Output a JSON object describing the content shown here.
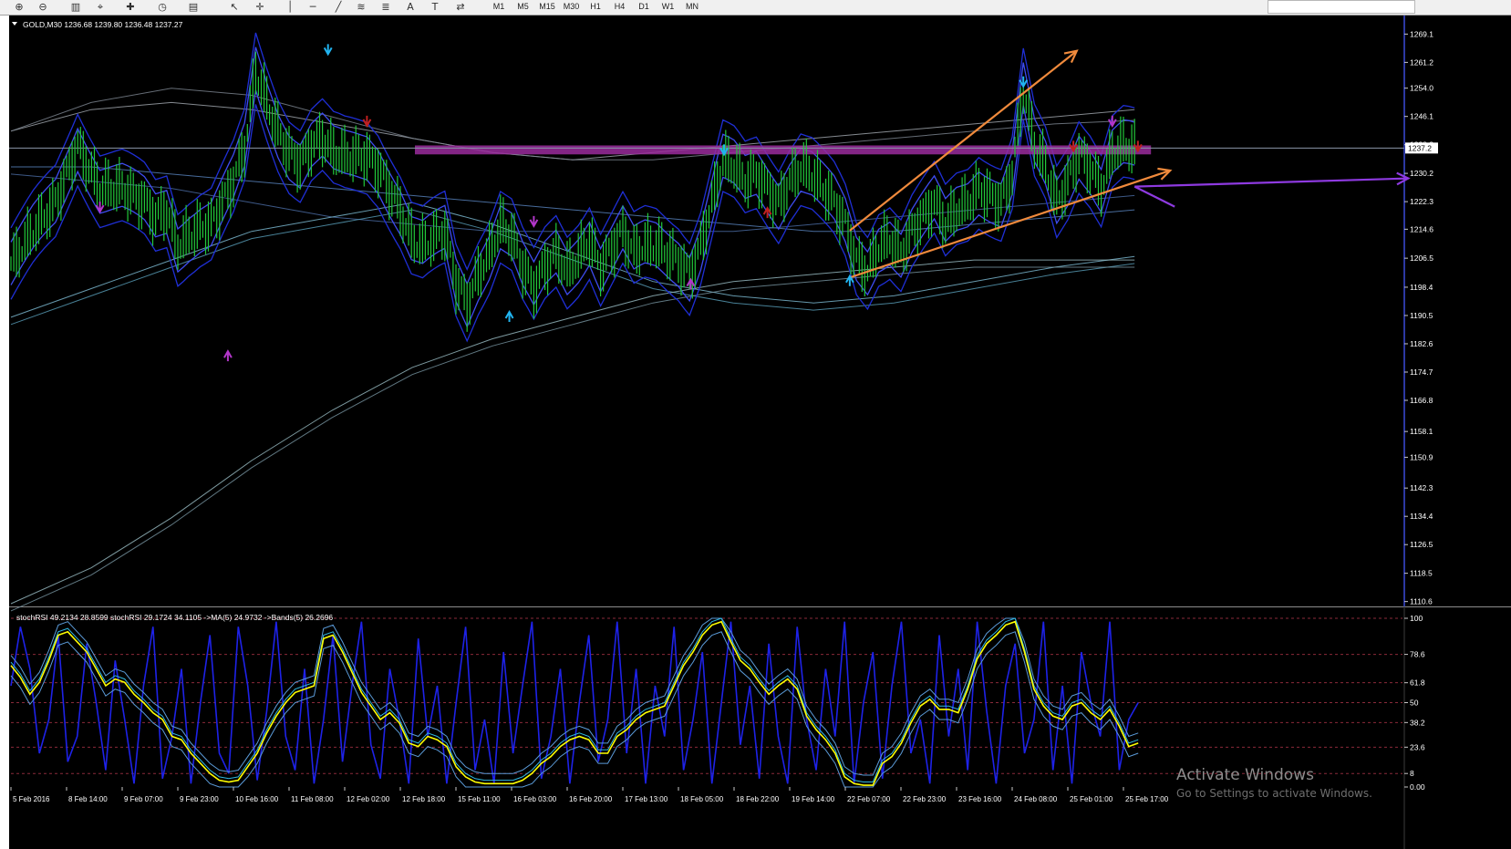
{
  "toolbar": {
    "icons": [
      "zoom-in-icon",
      "zoom-out-icon",
      "chart-bars-icon",
      "crosshair-cursor-icon",
      "new-order-icon",
      "history-clock-icon",
      "template-icon",
      "arrow-cursor-icon",
      "crosshair-icon",
      "vertical-line-icon",
      "horizontal-line-icon",
      "trendline-icon",
      "fibonacci-icon",
      "channel-icon",
      "text-icon",
      "text-label-icon",
      "arrows-icon"
    ],
    "timeframes": [
      "M1",
      "M5",
      "M15",
      "M30",
      "H1",
      "H4",
      "D1",
      "W1",
      "MN"
    ]
  },
  "chart_data": [
    {
      "type": "line",
      "header": "GOLD,M30  1236.68 1239.80 1236.48 1237.27",
      "symbol": "GOLD",
      "timeframe": "M30",
      "ohlc": {
        "open": 1236.68,
        "high": 1239.8,
        "low": 1236.48,
        "close": 1237.27
      },
      "current_price": 1237.27,
      "current_price_label": "1237.2",
      "ylim": [
        1110,
        1272
      ],
      "y_ticks": [
        "1269.1",
        "1261.2",
        "1254.0",
        "1246.1",
        "1238.2",
        "1230.2",
        "1222.3",
        "1214.6",
        "1206.5",
        "1198.4",
        "1190.5",
        "1182.6",
        "1174.7",
        "1166.8",
        "1158.1",
        "1150.9",
        "1142.3",
        "1134.4",
        "1126.5",
        "1118.5",
        "1110.6"
      ],
      "x_ticks": [
        "5 Feb 2016",
        "8 Feb 14:00",
        "9 Feb 07:00",
        "9 Feb 23:00",
        "10 Feb 16:00",
        "11 Feb 08:00",
        "12 Feb 02:00",
        "12 Feb 18:00",
        "15 Feb 11:00",
        "16 Feb 03:00",
        "16 Feb 20:00",
        "17 Feb 13:00",
        "18 Feb 05:00",
        "18 Feb 22:00",
        "19 Feb 14:00",
        "22 Feb 07:00",
        "22 Feb 23:00",
        "23 Feb 16:00",
        "24 Feb 08:00",
        "25 Feb 01:00",
        "25 Feb 17:00"
      ],
      "price_series": [
        [
          0,
          1205
        ],
        [
          2,
          1214
        ],
        [
          4,
          1222
        ],
        [
          6,
          1238
        ],
        [
          7,
          1232
        ],
        [
          8,
          1226
        ],
        [
          10,
          1226
        ],
        [
          12,
          1222
        ],
        [
          13,
          1218
        ],
        [
          14,
          1220
        ],
        [
          15,
          1210
        ],
        [
          16,
          1213
        ],
        [
          17,
          1215
        ],
        [
          18,
          1216
        ],
        [
          19,
          1222
        ],
        [
          20,
          1228
        ],
        [
          21,
          1237
        ],
        [
          22,
          1259
        ],
        [
          23,
          1250
        ],
        [
          24,
          1242
        ],
        [
          25,
          1236
        ],
        [
          26,
          1233
        ],
        [
          27,
          1238
        ],
        [
          28,
          1240
        ],
        [
          29,
          1236
        ],
        [
          30,
          1235
        ],
        [
          32,
          1235
        ],
        [
          33,
          1232
        ],
        [
          34,
          1226
        ],
        [
          35,
          1220
        ],
        [
          36,
          1212
        ],
        [
          37,
          1210
        ],
        [
          38,
          1212
        ],
        [
          39,
          1214
        ],
        [
          40,
          1200
        ],
        [
          41,
          1194
        ],
        [
          42,
          1202
        ],
        [
          43,
          1208
        ],
        [
          44,
          1216
        ],
        [
          45,
          1213
        ],
        [
          46,
          1204
        ],
        [
          47,
          1198
        ],
        [
          48,
          1204
        ],
        [
          49,
          1208
        ],
        [
          50,
          1203
        ],
        [
          51,
          1207
        ],
        [
          52,
          1212
        ],
        [
          53,
          1204
        ],
        [
          54,
          1209
        ],
        [
          55,
          1214
        ],
        [
          56,
          1208
        ],
        [
          57,
          1210
        ],
        [
          58,
          1210
        ],
        [
          59,
          1208
        ],
        [
          60,
          1206
        ],
        [
          61,
          1202
        ],
        [
          62,
          1210
        ],
        [
          63,
          1222
        ],
        [
          64,
          1234
        ],
        [
          65,
          1232
        ],
        [
          66,
          1228
        ],
        [
          67,
          1230
        ],
        [
          68,
          1226
        ],
        [
          69,
          1222
        ],
        [
          70,
          1228
        ],
        [
          71,
          1232
        ],
        [
          72,
          1230
        ],
        [
          73,
          1226
        ],
        [
          74,
          1222
        ],
        [
          75,
          1216
        ],
        [
          76,
          1206
        ],
        [
          77,
          1203
        ],
        [
          78,
          1210
        ],
        [
          79,
          1212
        ],
        [
          80,
          1208
        ],
        [
          81,
          1214
        ],
        [
          82,
          1218
        ],
        [
          83,
          1222
        ],
        [
          84,
          1216
        ],
        [
          85,
          1220
        ],
        [
          86,
          1222
        ],
        [
          87,
          1226
        ],
        [
          88,
          1224
        ],
        [
          89,
          1222
        ],
        [
          90,
          1230
        ],
        [
          91,
          1254
        ],
        [
          92,
          1238
        ],
        [
          93,
          1232
        ],
        [
          94,
          1222
        ],
        [
          95,
          1228
        ],
        [
          96,
          1236
        ],
        [
          97,
          1232
        ],
        [
          98,
          1226
        ],
        [
          99,
          1236
        ],
        [
          100,
          1238
        ],
        [
          101,
          1237
        ]
      ],
      "channel_lines": [
        {
          "ys": [
            1242,
            1248,
            1250,
            1248,
            1244,
            1240,
            1236,
            1234,
            1236,
            1238,
            1240,
            1242,
            1244,
            1246,
            1248
          ]
        },
        {
          "ys": [
            1242,
            1250,
            1254,
            1252,
            1246,
            1240,
            1236,
            1234,
            1234,
            1236,
            1238,
            1240,
            1242,
            1244,
            1245
          ]
        },
        {
          "ys": [
            1232,
            1232,
            1230,
            1228,
            1226,
            1224,
            1222,
            1220,
            1218,
            1216,
            1214,
            1214,
            1216,
            1218,
            1220
          ]
        },
        {
          "ys": [
            1230,
            1228,
            1226,
            1222,
            1218,
            1216,
            1214,
            1214,
            1214,
            1214,
            1216,
            1218,
            1220,
            1222,
            1224
          ]
        },
        {
          "ys": [
            1190,
            1198,
            1206,
            1214,
            1218,
            1222,
            1216,
            1208,
            1200,
            1196,
            1194,
            1196,
            1200,
            1204,
            1207
          ]
        },
        {
          "ys": [
            1188,
            1196,
            1204,
            1212,
            1216,
            1220,
            1214,
            1206,
            1198,
            1194,
            1192,
            1194,
            1198,
            1202,
            1205
          ]
        },
        {
          "ys": [
            1110,
            1120,
            1134,
            1150,
            1164,
            1176,
            1184,
            1190,
            1196,
            1200,
            1202,
            1204,
            1206,
            1206,
            1206
          ]
        },
        {
          "ys": [
            1108,
            1118,
            1132,
            1148,
            1162,
            1174,
            1182,
            1188,
            1194,
            1198,
            1200,
            1202,
            1204,
            1204,
            1204
          ]
        }
      ],
      "resistance_zone": {
        "low": 1235.5,
        "high": 1238.0,
        "color": "#9a2b9c"
      },
      "trendlines": [
        {
          "color": "#f08a3c",
          "from": [
            75.4,
            1214.2
          ],
          "to": [
            95.8,
            1264.4
          ]
        },
        {
          "color": "#f08a3c",
          "from": [
            75.3,
            1201.0
          ],
          "to": [
            104.2,
            1231.0
          ]
        },
        {
          "color": "#8e3ae0",
          "from": [
            101.0,
            1226.5
          ],
          "to": [
            125.6,
            1228.8
          ]
        }
      ],
      "arrow_markers": [
        {
          "i": 28.5,
          "y": 1264,
          "dir": "down",
          "color": "#21b4f0"
        },
        {
          "i": 44.8,
          "y": 1191,
          "dir": "up",
          "color": "#21b4f0"
        },
        {
          "i": 64.1,
          "y": 1236,
          "dir": "down",
          "color": "#21b4f0"
        },
        {
          "i": 75.4,
          "y": 1201,
          "dir": "up",
          "color": "#21b4f0"
        },
        {
          "i": 91.0,
          "y": 1255,
          "dir": "down",
          "color": "#21b4f0"
        },
        {
          "i": 8.0,
          "y": 1220,
          "dir": "down",
          "color": "#b236c9"
        },
        {
          "i": 19.5,
          "y": 1180,
          "dir": "up",
          "color": "#b236c9"
        },
        {
          "i": 47.0,
          "y": 1216,
          "dir": "down",
          "color": "#b236c9"
        },
        {
          "i": 61.1,
          "y": 1200,
          "dir": "up",
          "color": "#b236c9"
        },
        {
          "i": 99.0,
          "y": 1244,
          "dir": "down",
          "color": "#b236c9"
        },
        {
          "i": 101.3,
          "y": 1237,
          "dir": "down",
          "color": "#c02020"
        },
        {
          "i": 32.0,
          "y": 1244,
          "dir": "down",
          "color": "#c02020"
        },
        {
          "i": 68.0,
          "y": 1220,
          "dir": "up",
          "color": "#c02020"
        },
        {
          "i": 95.5,
          "y": 1237,
          "dir": "down",
          "color": "#c02020"
        }
      ]
    },
    {
      "type": "line",
      "header": "stochRSI 49.2134 28.8599  stochRSI 29.1724 34.1105  ->MA(5) 24.9732  ->Bands(5) 26.2696",
      "ylim": [
        0,
        100
      ],
      "y_ticks": [
        "100",
        "78.6",
        "61.8",
        "50",
        "38.2",
        "23.6",
        "8",
        "0.00"
      ],
      "levels": [
        100,
        78.6,
        61.8,
        50,
        38.2,
        23.6,
        8
      ],
      "series": [
        {
          "color": "#ffff00",
          "values": [
            72,
            65,
            55,
            62,
            75,
            90,
            92,
            86,
            80,
            70,
            60,
            64,
            62,
            55,
            50,
            44,
            40,
            30,
            28,
            20,
            14,
            8,
            4,
            3,
            4,
            12,
            20,
            32,
            42,
            50,
            56,
            58,
            60,
            88,
            90,
            80,
            68,
            56,
            48,
            40,
            44,
            38,
            26,
            24,
            30,
            28,
            24,
            12,
            6,
            3,
            2,
            2,
            2,
            2,
            4,
            8,
            14,
            18,
            24,
            28,
            30,
            28,
            20,
            20,
            30,
            34,
            40,
            44,
            46,
            48,
            60,
            72,
            80,
            90,
            96,
            98,
            86,
            75,
            70,
            62,
            55,
            60,
            64,
            58,
            42,
            34,
            28,
            20,
            6,
            2,
            1,
            1,
            14,
            18,
            26,
            38,
            48,
            52,
            46,
            46,
            44,
            58,
            76,
            85,
            90,
            96,
            98,
            80,
            58,
            48,
            42,
            40,
            48,
            50,
            44,
            40,
            46,
            36,
            24,
            26
          ]
        },
        {
          "color": "#1e22e8",
          "values": [
            60,
            95,
            70,
            20,
            40,
            90,
            15,
            30,
            85,
            50,
            10,
            75,
            40,
            2,
            60,
            95,
            5,
            30,
            70,
            2,
            50,
            90,
            20,
            8,
            95,
            60,
            4,
            45,
            98,
            30,
            10,
            70,
            2,
            40,
            90,
            15,
            60,
            98,
            25,
            5,
            70,
            40,
            2,
            88,
            30,
            60,
            2,
            50,
            95,
            10,
            40,
            2,
            80,
            20,
            60,
            98,
            5,
            30,
            70,
            2,
            50,
            90,
            15,
            40,
            98,
            20,
            70,
            2,
            60,
            30,
            95,
            10,
            40,
            80,
            2,
            50,
            98,
            25,
            60,
            5,
            85,
            30,
            2,
            95,
            40,
            10,
            70,
            30,
            98,
            2,
            50,
            80,
            5,
            60,
            98,
            20,
            40,
            2,
            90,
            30,
            70,
            10,
            98,
            45,
            2,
            60,
            85,
            20,
            40,
            98,
            10,
            60,
            2,
            80,
            50,
            30,
            98,
            10,
            40,
            50
          ]
        }
      ]
    }
  ],
  "watermark": {
    "line1": "Activate Windows",
    "line2": "Go to Settings to activate Windows."
  }
}
